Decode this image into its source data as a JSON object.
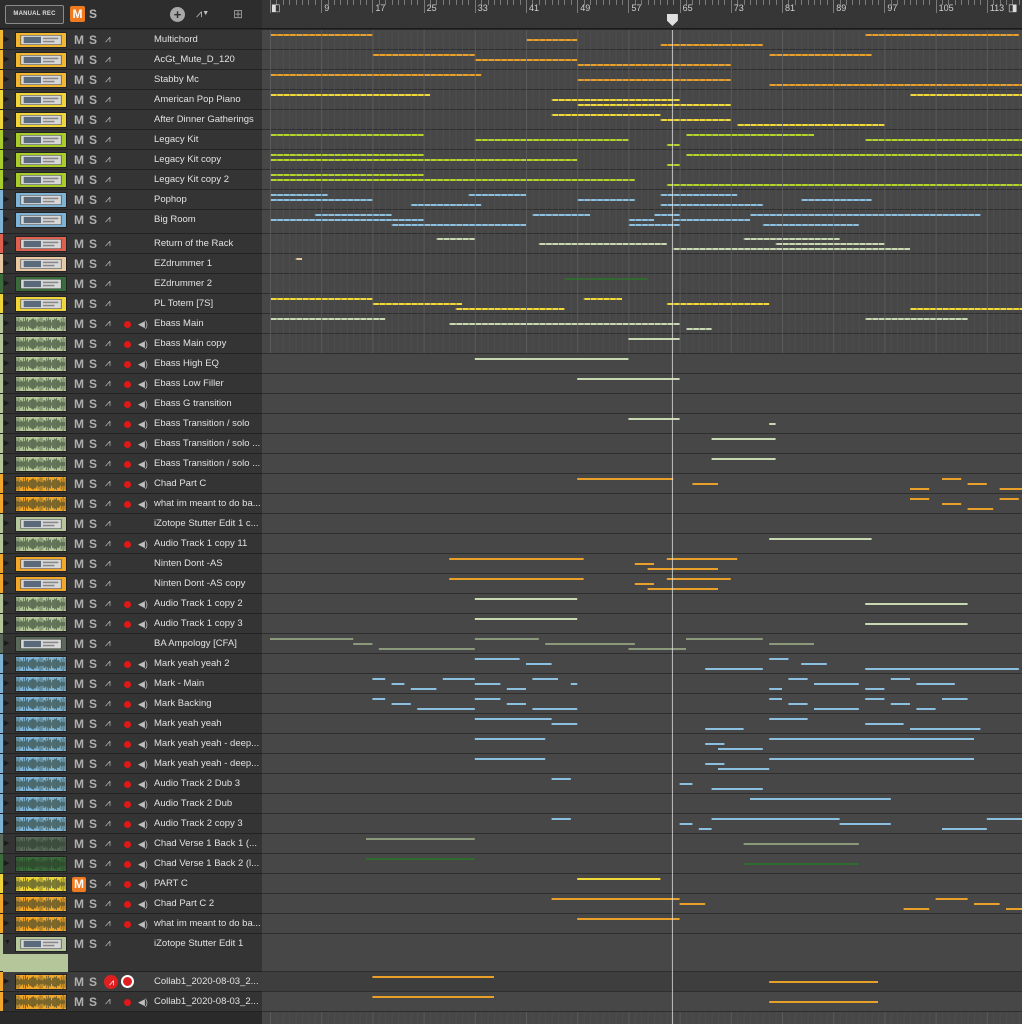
{
  "toolbar": {
    "manual_rec_label": "MANUAL REC",
    "master_mute": "M",
    "master_solo": "S",
    "add_track_icon": "plus-icon",
    "automation_icon": "automation-icon",
    "grid_icon": "grid-icon"
  },
  "ruler": {
    "bars": [
      "9",
      "17",
      "25",
      "33",
      "41",
      "49",
      "57",
      "65",
      "73",
      "81",
      "89",
      "97",
      "105",
      "113"
    ],
    "playhead_bar": 63.8
  },
  "colors": {
    "orange": "#f2a62a",
    "yellow": "#efd53a",
    "lime": "#a8cc2a",
    "blue": "#7fb3d5",
    "sage": "#b5c79a",
    "darkgreen": "#3a6b3a",
    "peach": "#e8c8a0",
    "grey_green": "#8a9a7a",
    "clip_orange": "#e8a02a",
    "clip_yellow": "#f0d838",
    "clip_lime": "#b4d42a",
    "clip_blue": "#8cc0e0",
    "clip_sage": "#c8d8b0",
    "clip_dkgreen": "#2f6b2f"
  },
  "tracks": [
    {
      "name": "Multichord",
      "color": "#f2b630",
      "kind": "inst",
      "clip": "#e8a02a",
      "h": 20,
      "clips": [
        [
          1,
          17
        ],
        [
          41,
          49
        ],
        [
          62,
          78
        ],
        [
          94,
          118
        ]
      ]
    },
    {
      "name": "AcGt_Mute_D_120",
      "color": "#f2b630",
      "kind": "inst",
      "clip": "#e8a02a",
      "h": 20,
      "clips": [
        [
          17,
          33
        ],
        [
          33,
          49
        ],
        [
          49,
          73
        ],
        [
          79,
          95
        ]
      ]
    },
    {
      "name": "Stabby Mc",
      "color": "#f2b630",
      "kind": "inst",
      "clip": "#e8a02a",
      "h": 20,
      "clips": [
        [
          1,
          34
        ],
        [
          49,
          73
        ],
        [
          79,
          119
        ]
      ]
    },
    {
      "name": "American Pop Piano",
      "color": "#efd53a",
      "kind": "inst",
      "clip": "#f0d838",
      "h": 20,
      "clips": [
        [
          1,
          26
        ],
        [
          45,
          65
        ],
        [
          49,
          73
        ],
        [
          101,
          121
        ]
      ]
    },
    {
      "name": "After Dinner Gatherings",
      "color": "#efd53a",
      "kind": "inst",
      "clip": "#f0d838",
      "h": 20,
      "clips": [
        [
          45,
          62
        ],
        [
          62,
          73
        ],
        [
          74,
          97
        ]
      ]
    },
    {
      "name": "Legacy Kit",
      "color": "#a8cc2a",
      "kind": "inst",
      "clip": "#b4d42a",
      "h": 20,
      "clips": [
        [
          1,
          25
        ],
        [
          33,
          57
        ],
        [
          63,
          65
        ],
        [
          66,
          86
        ],
        [
          94,
          121
        ]
      ]
    },
    {
      "name": "Legacy Kit copy",
      "color": "#a8cc2a",
      "kind": "inst",
      "clip": "#b4d42a",
      "h": 20,
      "clips": [
        [
          1,
          25
        ],
        [
          1,
          49
        ],
        [
          63,
          65
        ],
        [
          66,
          121
        ]
      ]
    },
    {
      "name": "Legacy Kit copy 2",
      "color": "#a8cc2a",
      "kind": "inst",
      "clip": "#b4d42a",
      "h": 20,
      "clips": [
        [
          1,
          25
        ],
        [
          1,
          58
        ],
        [
          63,
          121
        ]
      ]
    },
    {
      "name": "Pophop",
      "color": "#7fb3d5",
      "kind": "inst",
      "clip": "#8cc0e0",
      "h": 20,
      "clips": [
        [
          1,
          10
        ],
        [
          1,
          17
        ],
        [
          23,
          34
        ],
        [
          32,
          41
        ],
        [
          49,
          58
        ],
        [
          62,
          78
        ],
        [
          62,
          74
        ],
        [
          84,
          95
        ]
      ]
    },
    {
      "name": "Big Room",
      "color": "#7fb3d5",
      "kind": "inst",
      "clip": "#8cc0e0",
      "h": 24,
      "clips": [
        [
          8,
          20
        ],
        [
          1,
          25
        ],
        [
          20,
          41
        ],
        [
          42,
          51
        ],
        [
          57,
          61
        ],
        [
          57,
          65
        ],
        [
          61,
          65
        ],
        [
          64,
          76
        ],
        [
          78,
          93
        ],
        [
          76,
          112
        ]
      ]
    },
    {
      "name": "Return of the Rack",
      "color": "#e06050",
      "kind": "inst",
      "clip": "#c8d8b0",
      "h": 20,
      "clips": [
        [
          27,
          33
        ],
        [
          43,
          63
        ],
        [
          64,
          101
        ],
        [
          75,
          90
        ],
        [
          80,
          97
        ]
      ]
    },
    {
      "name": "EZdrummer 1",
      "color": "#e8c8a0",
      "kind": "inst",
      "clip": "#e8c8a0",
      "h": 20,
      "clips": [
        [
          5,
          6
        ]
      ]
    },
    {
      "name": "EZdrummer 2",
      "color": "#3a6b3a",
      "kind": "inst",
      "clip": "#2f6b2f",
      "h": 20,
      "clips": [
        [
          47,
          60
        ]
      ]
    },
    {
      "name": "PL Totem [7S]",
      "color": "#efd53a",
      "kind": "inst",
      "clip": "#f0d838",
      "h": 20,
      "clips": [
        [
          1,
          17
        ],
        [
          17,
          31
        ],
        [
          30,
          47
        ],
        [
          50,
          56
        ],
        [
          63,
          79
        ],
        [
          101,
          121
        ]
      ]
    },
    {
      "name": "Ebass Main",
      "color": "#b5c79a",
      "kind": "audio",
      "clip": "#c8d8b0",
      "h": 20,
      "clips": [
        [
          1,
          19
        ],
        [
          29,
          65
        ],
        [
          66,
          70
        ],
        [
          94,
          110
        ]
      ]
    },
    {
      "name": "Ebass Main copy",
      "color": "#b5c79a",
      "kind": "audio",
      "clip": "#c8d8b0",
      "h": 20,
      "clips": [
        [
          57,
          65
        ]
      ]
    },
    {
      "name": "Ebass High EQ",
      "color": "#b5c79a",
      "kind": "audio",
      "clip": "#c8d8b0",
      "h": 20,
      "clips": [
        [
          33,
          57
        ]
      ]
    },
    {
      "name": "Ebass Low Filler",
      "color": "#b5c79a",
      "kind": "audio",
      "clip": "#c8d8b0",
      "h": 20,
      "clips": [
        [
          49,
          65
        ]
      ]
    },
    {
      "name": "Ebass G transition",
      "color": "#b5c79a",
      "kind": "audio",
      "clip": "#c8d8b0",
      "h": 20,
      "clips": []
    },
    {
      "name": "Ebass Transition / solo",
      "color": "#b5c79a",
      "kind": "audio",
      "clip": "#c8d8b0",
      "h": 20,
      "clips": [
        [
          57,
          65
        ],
        [
          79,
          80
        ]
      ]
    },
    {
      "name": "Ebass Transition / solo ...",
      "color": "#b5c79a",
      "kind": "audio",
      "clip": "#c8d8b0",
      "h": 20,
      "clips": [
        [
          70,
          80
        ]
      ]
    },
    {
      "name": "Ebass Transition / solo ...",
      "color": "#b5c79a",
      "kind": "audio",
      "clip": "#c8d8b0",
      "h": 20,
      "clips": [
        [
          70,
          80
        ]
      ]
    },
    {
      "name": "Chad Part C",
      "color": "#f2a62a",
      "kind": "audio",
      "clip": "#e8a02a",
      "h": 20,
      "clips": [
        [
          49,
          64
        ],
        [
          67,
          71
        ],
        [
          101,
          104
        ],
        [
          106,
          109
        ],
        [
          110,
          113
        ],
        [
          115,
          120
        ]
      ]
    },
    {
      "name": "what im meant to do ba...",
      "color": "#f2a62a",
      "kind": "audio",
      "clip": "#e8a02a",
      "h": 20,
      "clips": [
        [
          101,
          104
        ],
        [
          106,
          109
        ],
        [
          110,
          114
        ],
        [
          115,
          118
        ]
      ]
    },
    {
      "name": "iZotope Stutter Edit 1 c...",
      "color": "#b5c79a",
      "kind": "inst",
      "clip": "#c8d8b0",
      "h": 20,
      "clips": []
    },
    {
      "name": "Audio Track 1 copy 11",
      "color": "#b5c79a",
      "kind": "audio",
      "clip": "#c8d8b0",
      "h": 20,
      "clips": [
        [
          79,
          95
        ]
      ]
    },
    {
      "name": "Ninten Dont  -AS",
      "color": "#f2a62a",
      "kind": "inst",
      "clip": "#e8a02a",
      "h": 20,
      "clips": [
        [
          29,
          50
        ],
        [
          58,
          61
        ],
        [
          60,
          71
        ],
        [
          63,
          74
        ]
      ]
    },
    {
      "name": "Ninten Dont  -AS copy",
      "color": "#f2a62a",
      "kind": "inst",
      "clip": "#e8a02a",
      "h": 20,
      "clips": [
        [
          29,
          50
        ],
        [
          58,
          61
        ],
        [
          60,
          71
        ],
        [
          63,
          73
        ]
      ]
    },
    {
      "name": "Audio Track 1 copy 2",
      "color": "#b5c79a",
      "kind": "audio",
      "clip": "#c8d8b0",
      "h": 20,
      "clips": [
        [
          33,
          49
        ],
        [
          94,
          110
        ]
      ]
    },
    {
      "name": "Audio Track 1 copy 3",
      "color": "#b5c79a",
      "kind": "audio",
      "clip": "#c8d8b0",
      "h": 20,
      "clips": [
        [
          33,
          49
        ],
        [
          94,
          110
        ]
      ]
    },
    {
      "name": "BA Ampology [CFA]",
      "color": "#5a6a5a",
      "kind": "inst",
      "clip": "#8a9a7a",
      "h": 20,
      "clips": [
        [
          1,
          14
        ],
        [
          14,
          17
        ],
        [
          18,
          33
        ],
        [
          33,
          43
        ],
        [
          44,
          58
        ],
        [
          57,
          66
        ],
        [
          66,
          78
        ],
        [
          79,
          86
        ]
      ]
    },
    {
      "name": "Mark yeah yeah 2",
      "color": "#7fb3d5",
      "kind": "audio",
      "clip": "#8cc0e0",
      "h": 20,
      "clips": [
        [
          33,
          40
        ],
        [
          41,
          45
        ],
        [
          69,
          78
        ],
        [
          79,
          82
        ],
        [
          84,
          88
        ],
        [
          94,
          118
        ]
      ]
    },
    {
      "name": "Mark - Main",
      "color": "#7fb3d5",
      "kind": "audio",
      "clip": "#8cc0e0",
      "h": 20,
      "clips": [
        [
          17,
          19
        ],
        [
          20,
          22
        ],
        [
          23,
          27
        ],
        [
          28,
          33
        ],
        [
          33,
          37
        ],
        [
          38,
          41
        ],
        [
          42,
          46
        ],
        [
          48,
          49
        ],
        [
          79,
          81
        ],
        [
          82,
          85
        ],
        [
          86,
          93
        ],
        [
          94,
          97
        ],
        [
          98,
          101
        ],
        [
          102,
          108
        ]
      ]
    },
    {
      "name": "Mark Backing",
      "color": "#7fb3d5",
      "kind": "audio",
      "clip": "#8cc0e0",
      "h": 20,
      "clips": [
        [
          17,
          19
        ],
        [
          20,
          23
        ],
        [
          24,
          33
        ],
        [
          33,
          37
        ],
        [
          38,
          41
        ],
        [
          42,
          49
        ],
        [
          79,
          81
        ],
        [
          82,
          85
        ],
        [
          86,
          93
        ],
        [
          94,
          97
        ],
        [
          98,
          101
        ],
        [
          102,
          105
        ],
        [
          106,
          110
        ]
      ]
    },
    {
      "name": "Mark yeah yeah",
      "color": "#7fb3d5",
      "kind": "audio",
      "clip": "#8cc0e0",
      "h": 20,
      "clips": [
        [
          33,
          45
        ],
        [
          45,
          49
        ],
        [
          69,
          75
        ],
        [
          79,
          85
        ],
        [
          94,
          100
        ],
        [
          101,
          112
        ]
      ]
    },
    {
      "name": "Mark yeah yeah - deep...",
      "color": "#7fb3d5",
      "kind": "audio",
      "clip": "#8cc0e0",
      "h": 20,
      "clips": [
        [
          33,
          44
        ],
        [
          69,
          72
        ],
        [
          71,
          78
        ],
        [
          79,
          111
        ]
      ]
    },
    {
      "name": "Mark yeah yeah - deep...",
      "color": "#7fb3d5",
      "kind": "audio",
      "clip": "#8cc0e0",
      "h": 20,
      "clips": [
        [
          33,
          44
        ],
        [
          69,
          72
        ],
        [
          71,
          79
        ],
        [
          79,
          111
        ]
      ]
    },
    {
      "name": "Audio Track 2 Dub 3",
      "color": "#7fb3d5",
      "kind": "audio",
      "clip": "#8cc0e0",
      "h": 20,
      "clips": [
        [
          45,
          48
        ],
        [
          65,
          67
        ],
        [
          70,
          78
        ]
      ]
    },
    {
      "name": "Audio Track 2 Dub",
      "color": "#7fb3d5",
      "kind": "audio",
      "clip": "#8cc0e0",
      "h": 20,
      "clips": [
        [
          76,
          98
        ]
      ]
    },
    {
      "name": "Audio Track 2 copy 3",
      "color": "#7fb3d5",
      "kind": "audio",
      "clip": "#8cc0e0",
      "h": 20,
      "clips": [
        [
          45,
          48
        ],
        [
          65,
          67
        ],
        [
          68,
          70
        ],
        [
          70,
          90
        ],
        [
          90,
          98
        ],
        [
          106,
          113
        ],
        [
          113,
          121
        ]
      ]
    },
    {
      "name": "Chad Verse 1 Back 1 (...",
      "color": "#5a6a5a",
      "kind": "audio",
      "clip": "#8a9a7a",
      "h": 20,
      "clips": [
        [
          16,
          33
        ],
        [
          75,
          93
        ]
      ]
    },
    {
      "name": "Chad Verse 1 Back 2 (l...",
      "color": "#3a6b3a",
      "kind": "audio",
      "clip": "#2f6b2f",
      "h": 20,
      "clips": [
        [
          16,
          33
        ],
        [
          75,
          93
        ]
      ]
    },
    {
      "name": "PART C",
      "color": "#efd53a",
      "kind": "audio",
      "clip": "#f0d838",
      "h": 20,
      "mute_on": true,
      "clips": [
        [
          49,
          62
        ]
      ]
    },
    {
      "name": "Chad Part C 2",
      "color": "#f2a62a",
      "kind": "audio",
      "clip": "#e8a02a",
      "h": 20,
      "clips": [
        [
          45,
          65
        ],
        [
          65,
          69
        ],
        [
          100,
          104
        ],
        [
          105,
          110
        ],
        [
          111,
          115
        ],
        [
          116,
          119
        ]
      ]
    },
    {
      "name": "what im meant to do ba...",
      "color": "#f2a62a",
      "kind": "audio",
      "clip": "#e8a02a",
      "h": 20,
      "clips": [
        [
          49,
          65
        ]
      ]
    },
    {
      "name": "iZotope Stutter Edit 1",
      "color": "#b5c79a",
      "kind": "inst",
      "clip": "#c8d8b0",
      "h": 38,
      "expanded": true,
      "clips": []
    },
    {
      "name": "Collab1_2020-08-03_2...",
      "color": "#f2a62a",
      "kind": "audio",
      "clip": "#e8a02a",
      "h": 20,
      "selected": true,
      "armed": true,
      "clips": [
        [
          17,
          36
        ],
        [
          79,
          96
        ]
      ]
    },
    {
      "name": "Collab1_2020-08-03_2...",
      "color": "#f2a62a",
      "kind": "audio",
      "clip": "#e8a02a",
      "h": 20,
      "clips": [
        [
          17,
          36
        ],
        [
          79,
          96
        ]
      ]
    }
  ]
}
